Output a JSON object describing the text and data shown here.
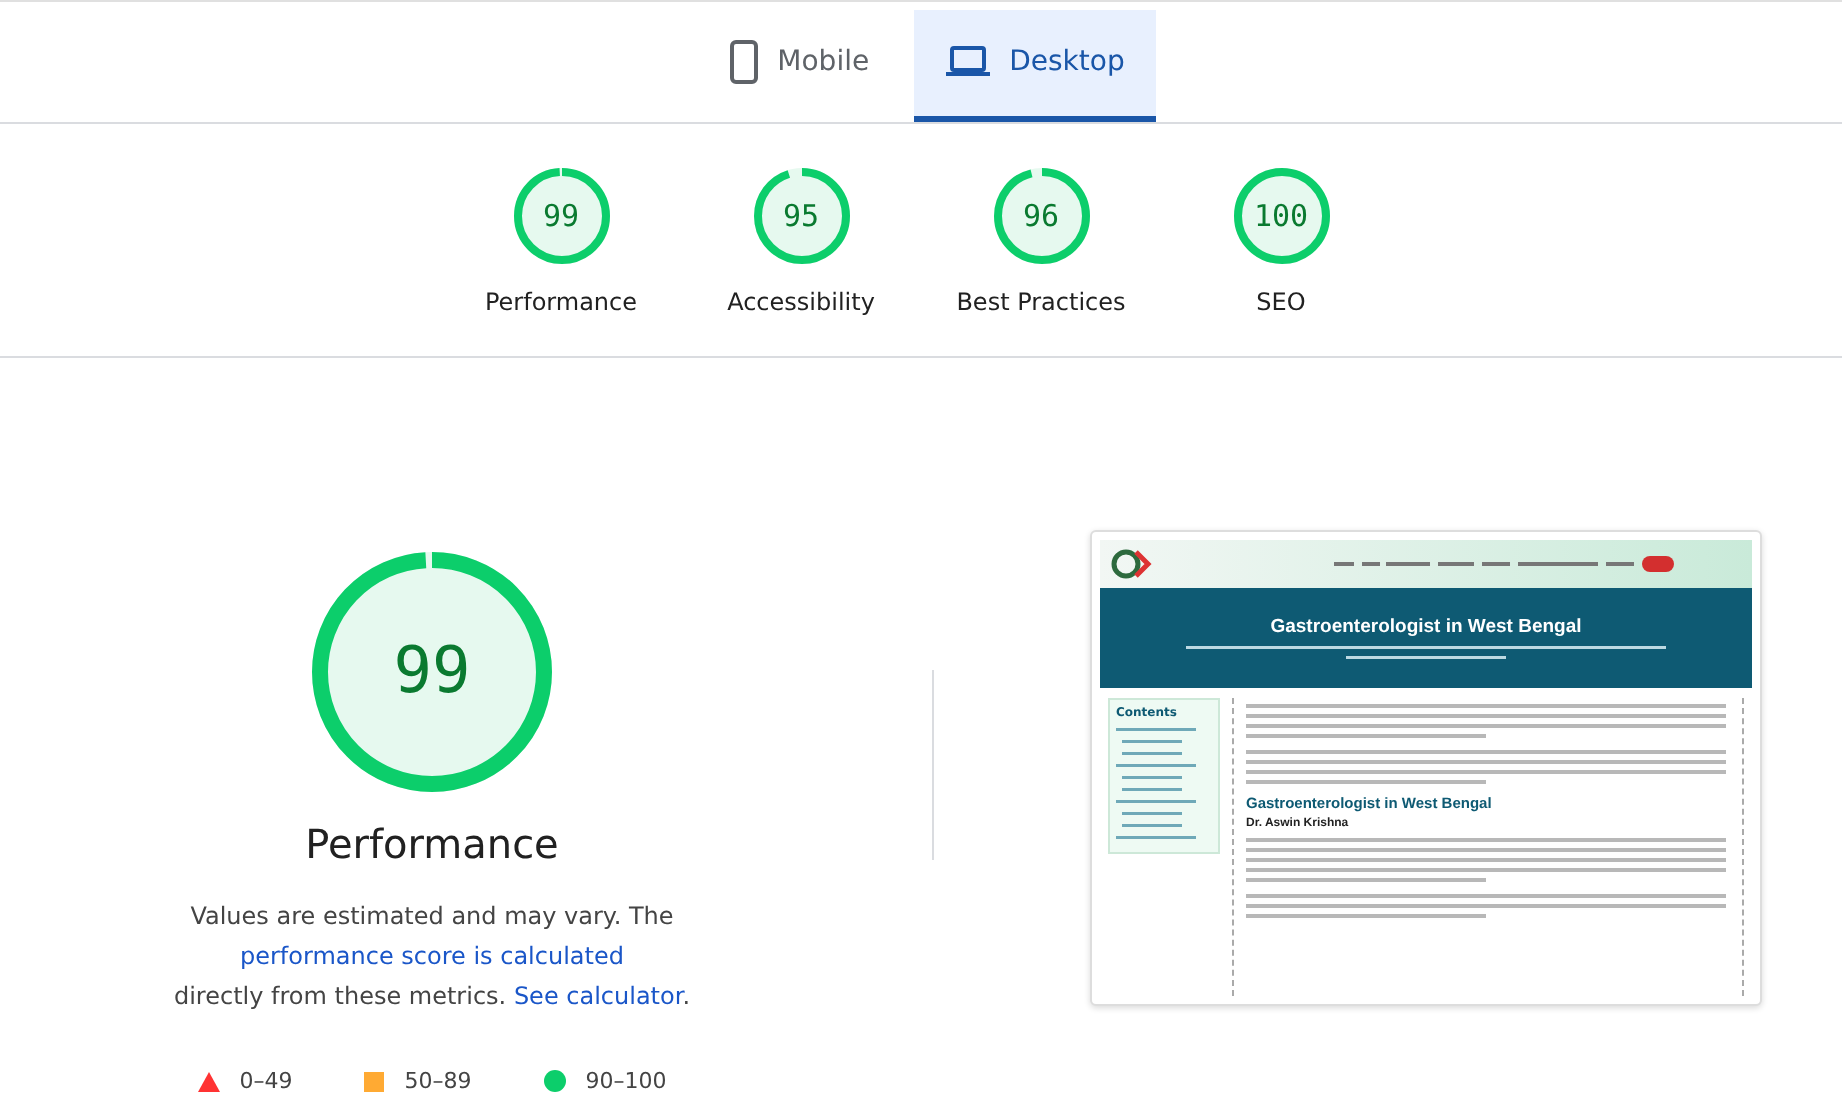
{
  "tabs": [
    {
      "label": "Mobile",
      "kind": "mobile",
      "selected": false
    },
    {
      "label": "Desktop",
      "kind": "desktop",
      "selected": true
    }
  ],
  "scores": [
    {
      "value": "99",
      "label": "Performance",
      "level": 0.99
    },
    {
      "value": "95",
      "label": "Accessibility",
      "level": 0.95
    },
    {
      "value": "96",
      "label": "Best Practices",
      "level": 0.96
    },
    {
      "value": "100",
      "label": "SEO",
      "level": 1
    }
  ],
  "main_gauge": {
    "value": "99",
    "level": 0.99,
    "title": "Performance"
  },
  "description": {
    "before": "Values are estimated and may vary. The ",
    "link1": "performance score is calculated",
    "middle": "directly from these metrics. ",
    "link2": "See calculator",
    "after": "."
  },
  "legend": [
    {
      "kind": "fail",
      "range": "0–49",
      "color": "#ff3333"
    },
    {
      "kind": "average",
      "range": "50–89",
      "color": "#ffaa33"
    },
    {
      "kind": "pass",
      "range": "90–100",
      "color": "#0cce6b"
    }
  ],
  "screenshot": {
    "headline": "Gastroenterologist in West Bengal",
    "contents_title": "Contents",
    "heading": "Gastroenterologist in West Bengal",
    "subheading": "Dr. Aswin Krishna"
  }
}
